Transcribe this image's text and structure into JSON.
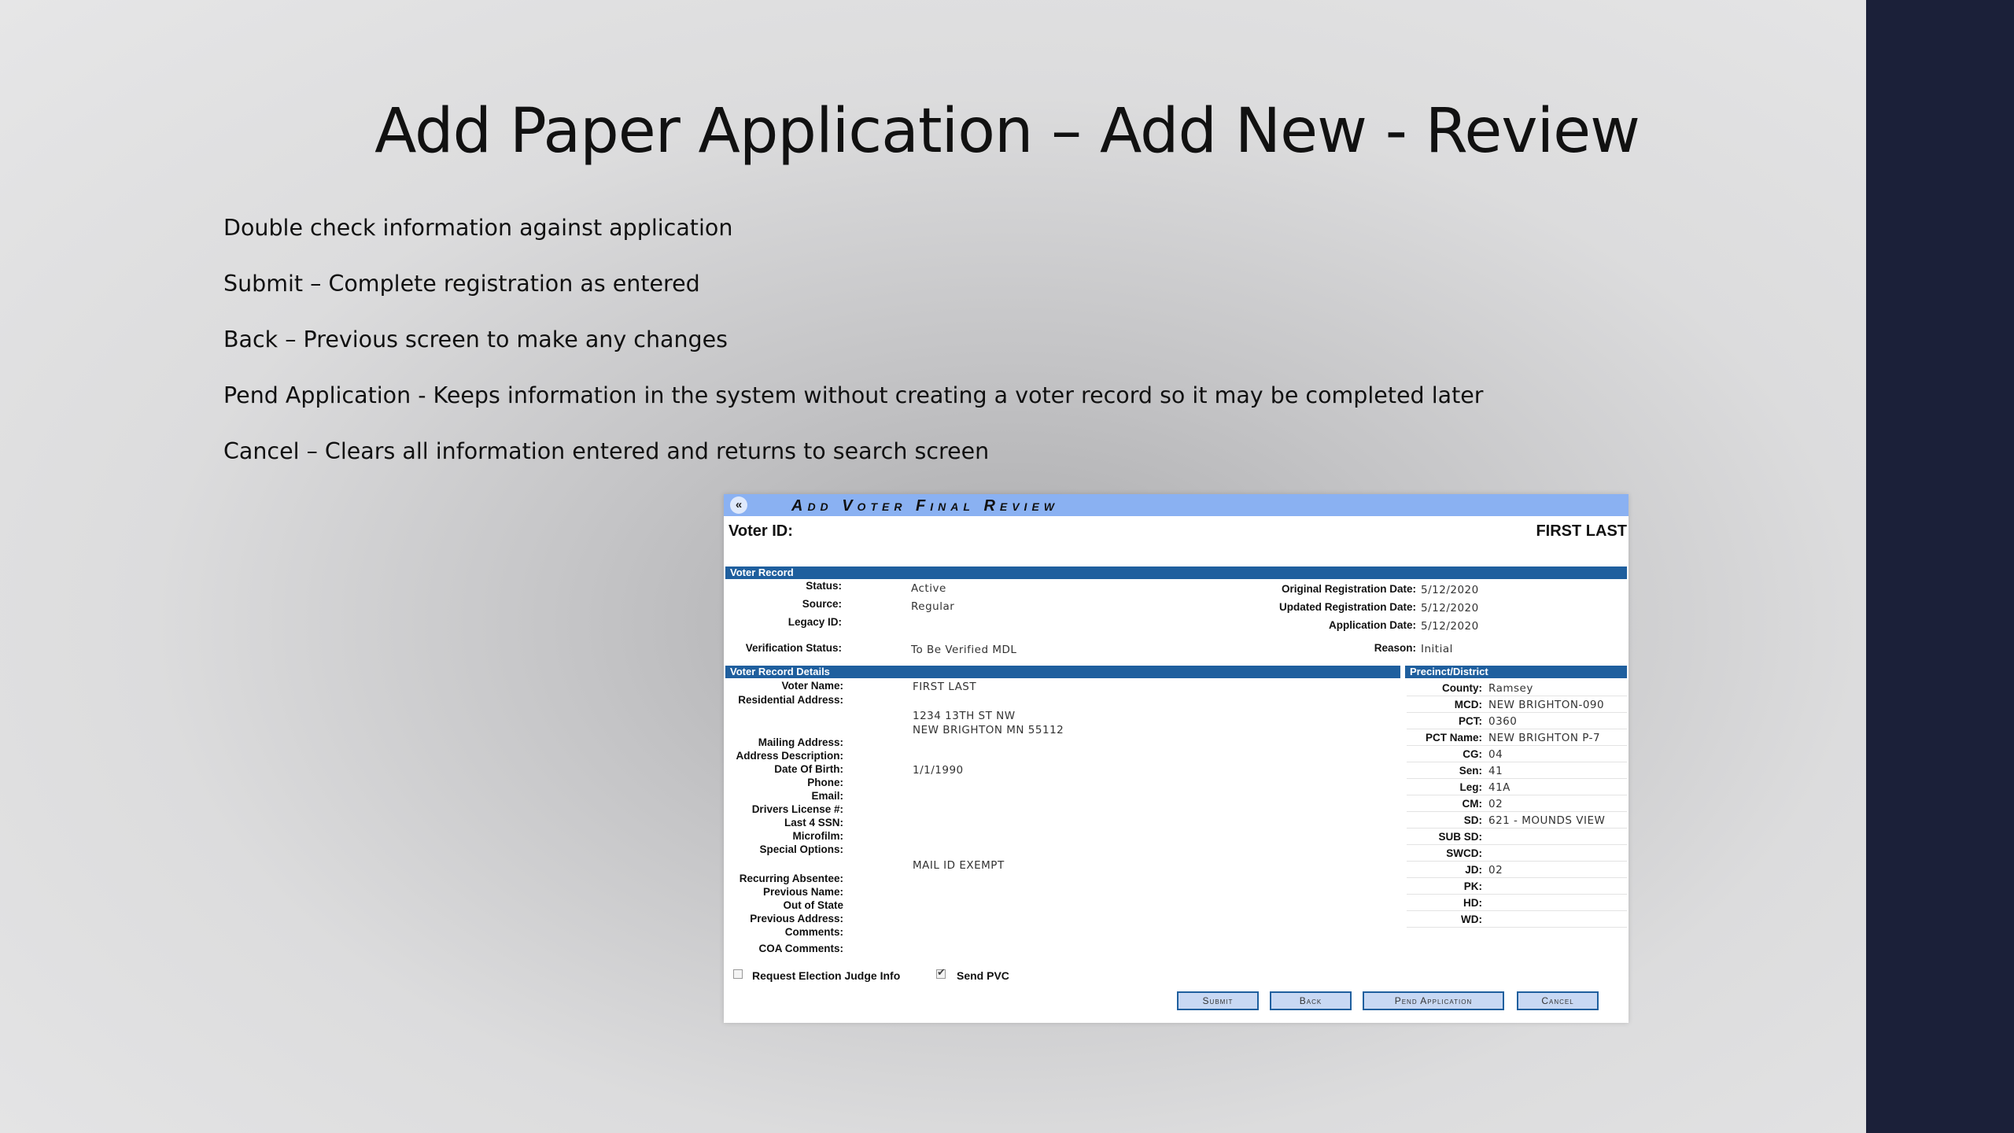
{
  "slide": {
    "title": "Add Paper Application – Add New - Review",
    "bullets": [
      "Double check information against application",
      "Submit – Complete registration as entered",
      "Back – Previous screen to make any changes",
      "Pend Application -  Keeps information in the system without creating a voter record so it may be completed later",
      "Cancel – Clears all information entered and returns to search screen"
    ]
  },
  "screen": {
    "back_glyph": "«",
    "title": "Add Voter Final Review",
    "voter_id_label": "Voter ID:",
    "voter_name_header": "FIRST LAST",
    "voter_record": {
      "header": "Voter Record",
      "status_label": "Status:",
      "status_value": "Active",
      "source_label": "Source:",
      "source_value": "Regular",
      "legacy_label": "Legacy ID:",
      "legacy_value": "",
      "verification_label": "Verification Status:",
      "verification_value": "To Be Verified MDL",
      "orig_reg_label": "Original Registration Date:",
      "orig_reg_value": "5/12/2020",
      "updated_reg_label": "Updated Registration Date:",
      "updated_reg_value": "5/12/2020",
      "app_date_label": "Application Date:",
      "app_date_value": "5/12/2020",
      "reason_label": "Reason:",
      "reason_value": "Initial"
    },
    "details": {
      "header": "Voter Record Details",
      "voter_name_label": "Voter Name:",
      "voter_name_value": "FIRST LAST",
      "res_addr_label": "Residential Address:",
      "res_addr_line1": "1234 13TH ST NW",
      "res_addr_line2": "NEW BRIGHTON MN 55112",
      "mailing_label": "Mailing Address:",
      "addr_desc_label": "Address Description:",
      "dob_label": "Date Of Birth:",
      "dob_value": "1/1/1990",
      "phone_label": "Phone:",
      "email_label": "Email:",
      "dl_label": "Drivers License #:",
      "ssn_label": "Last 4 SSN:",
      "microfilm_label": "Microfilm:",
      "special_label": "Special Options:",
      "special_value": "MAIL ID EXEMPT",
      "recurring_label": "Recurring Absentee:",
      "prev_name_label": "Previous Name:",
      "out_state_label": "Out of State",
      "prev_addr_label": "Previous Address:",
      "comments_label": "Comments:",
      "coa_label": "COA Comments:"
    },
    "precinct": {
      "header": "Precinct/District",
      "rows": [
        {
          "label": "County:",
          "value": "Ramsey"
        },
        {
          "label": "MCD:",
          "value": "NEW BRIGHTON-090"
        },
        {
          "label": "PCT:",
          "value": "0360"
        },
        {
          "label": "PCT Name:",
          "value": "NEW BRIGHTON P-7"
        },
        {
          "label": "CG:",
          "value": "04"
        },
        {
          "label": "Sen:",
          "value": "41"
        },
        {
          "label": "Leg:",
          "value": "41A"
        },
        {
          "label": "CM:",
          "value": "02"
        },
        {
          "label": "SD:",
          "value": "621 - MOUNDS VIEW"
        },
        {
          "label": "SUB SD:",
          "value": ""
        },
        {
          "label": "SWCD:",
          "value": ""
        },
        {
          "label": "JD:",
          "value": "02"
        },
        {
          "label": "PK:",
          "value": ""
        },
        {
          "label": "HD:",
          "value": ""
        },
        {
          "label": "WD:",
          "value": ""
        }
      ]
    },
    "checkboxes": {
      "judge_label": "Request Election Judge Info",
      "judge_checked": false,
      "pvc_label": "Send PVC",
      "pvc_checked": true
    },
    "buttons": {
      "submit": "Submit",
      "back": "Back",
      "pend": "Pend Application",
      "cancel": "Cancel"
    }
  },
  "colors": {
    "sidebar": "#1b2039",
    "title_bar": "#8ab1f2",
    "section_header": "#1f5f9e"
  }
}
